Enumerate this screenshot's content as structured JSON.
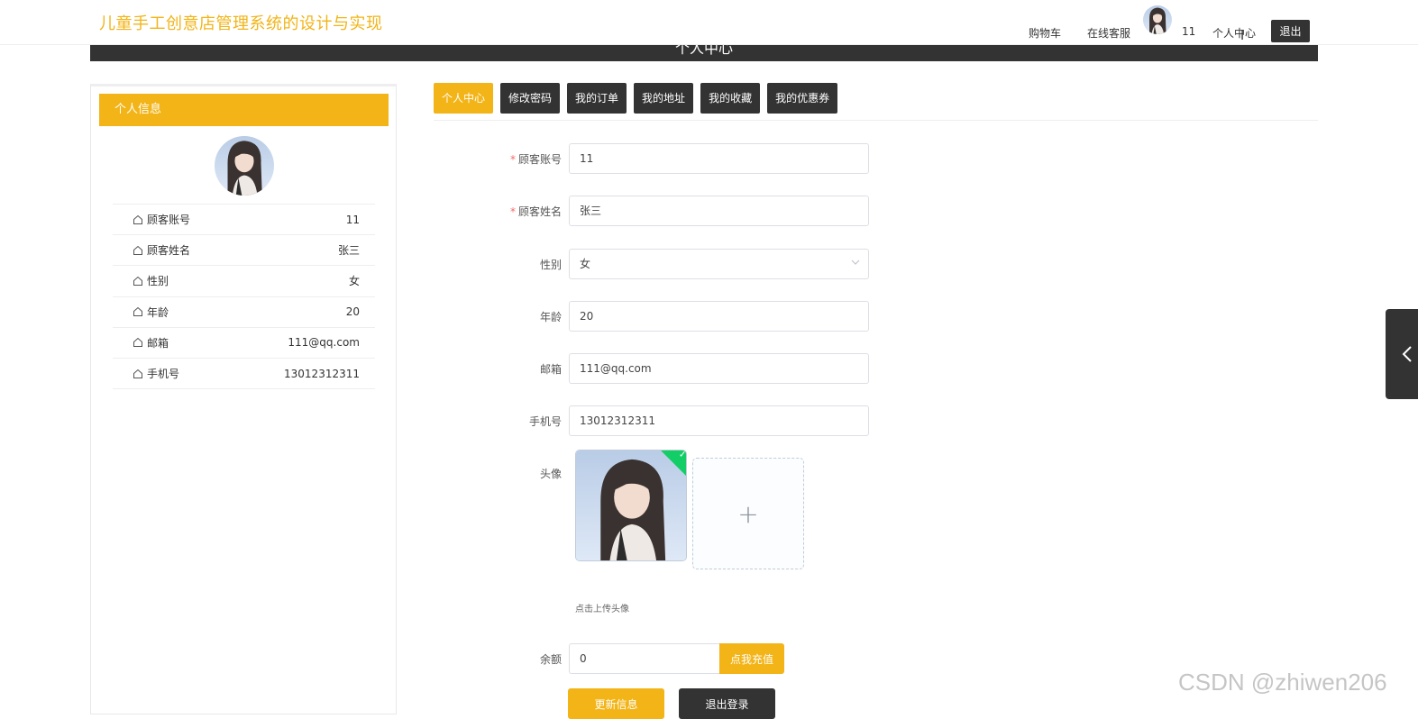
{
  "header": {
    "title": "儿童手工创意店管理系统的设计与实现",
    "cart": "购物车",
    "service": "在线客服",
    "username": "11",
    "profile": "个人中心",
    "logout": "退出"
  },
  "banner": {
    "title": "个人中心"
  },
  "sidebar": {
    "header": "个人信息",
    "rows": [
      {
        "label": "顾客账号",
        "value": "11"
      },
      {
        "label": "顾客姓名",
        "value": "张三"
      },
      {
        "label": "性别",
        "value": "女"
      },
      {
        "label": "年龄",
        "value": "20"
      },
      {
        "label": "邮箱",
        "value": "111@qq.com"
      },
      {
        "label": "手机号",
        "value": "13012312311"
      }
    ]
  },
  "tabs": [
    "个人中心",
    "修改密码",
    "我的订单",
    "我的地址",
    "我的收藏",
    "我的优惠券"
  ],
  "form": {
    "account": {
      "label": "顾客账号",
      "value": "11"
    },
    "name": {
      "label": "顾客姓名",
      "value": "张三"
    },
    "gender": {
      "label": "性别",
      "value": "女"
    },
    "age": {
      "label": "年龄",
      "value": "20"
    },
    "email": {
      "label": "邮箱",
      "value": "111@qq.com"
    },
    "phone": {
      "label": "手机号",
      "value": "13012312311"
    },
    "avatar": {
      "label": "头像",
      "hint": "点击上传头像"
    },
    "balance": {
      "label": "余额",
      "value": "0",
      "recharge": "点我充值"
    },
    "update": "更新信息",
    "logout": "退出登录"
  },
  "required_mark": "*",
  "watermark": "CSDN @zhiwen206",
  "colors": {
    "accent": "#f2b417",
    "dark": "#333333",
    "success": "#13ce66"
  }
}
